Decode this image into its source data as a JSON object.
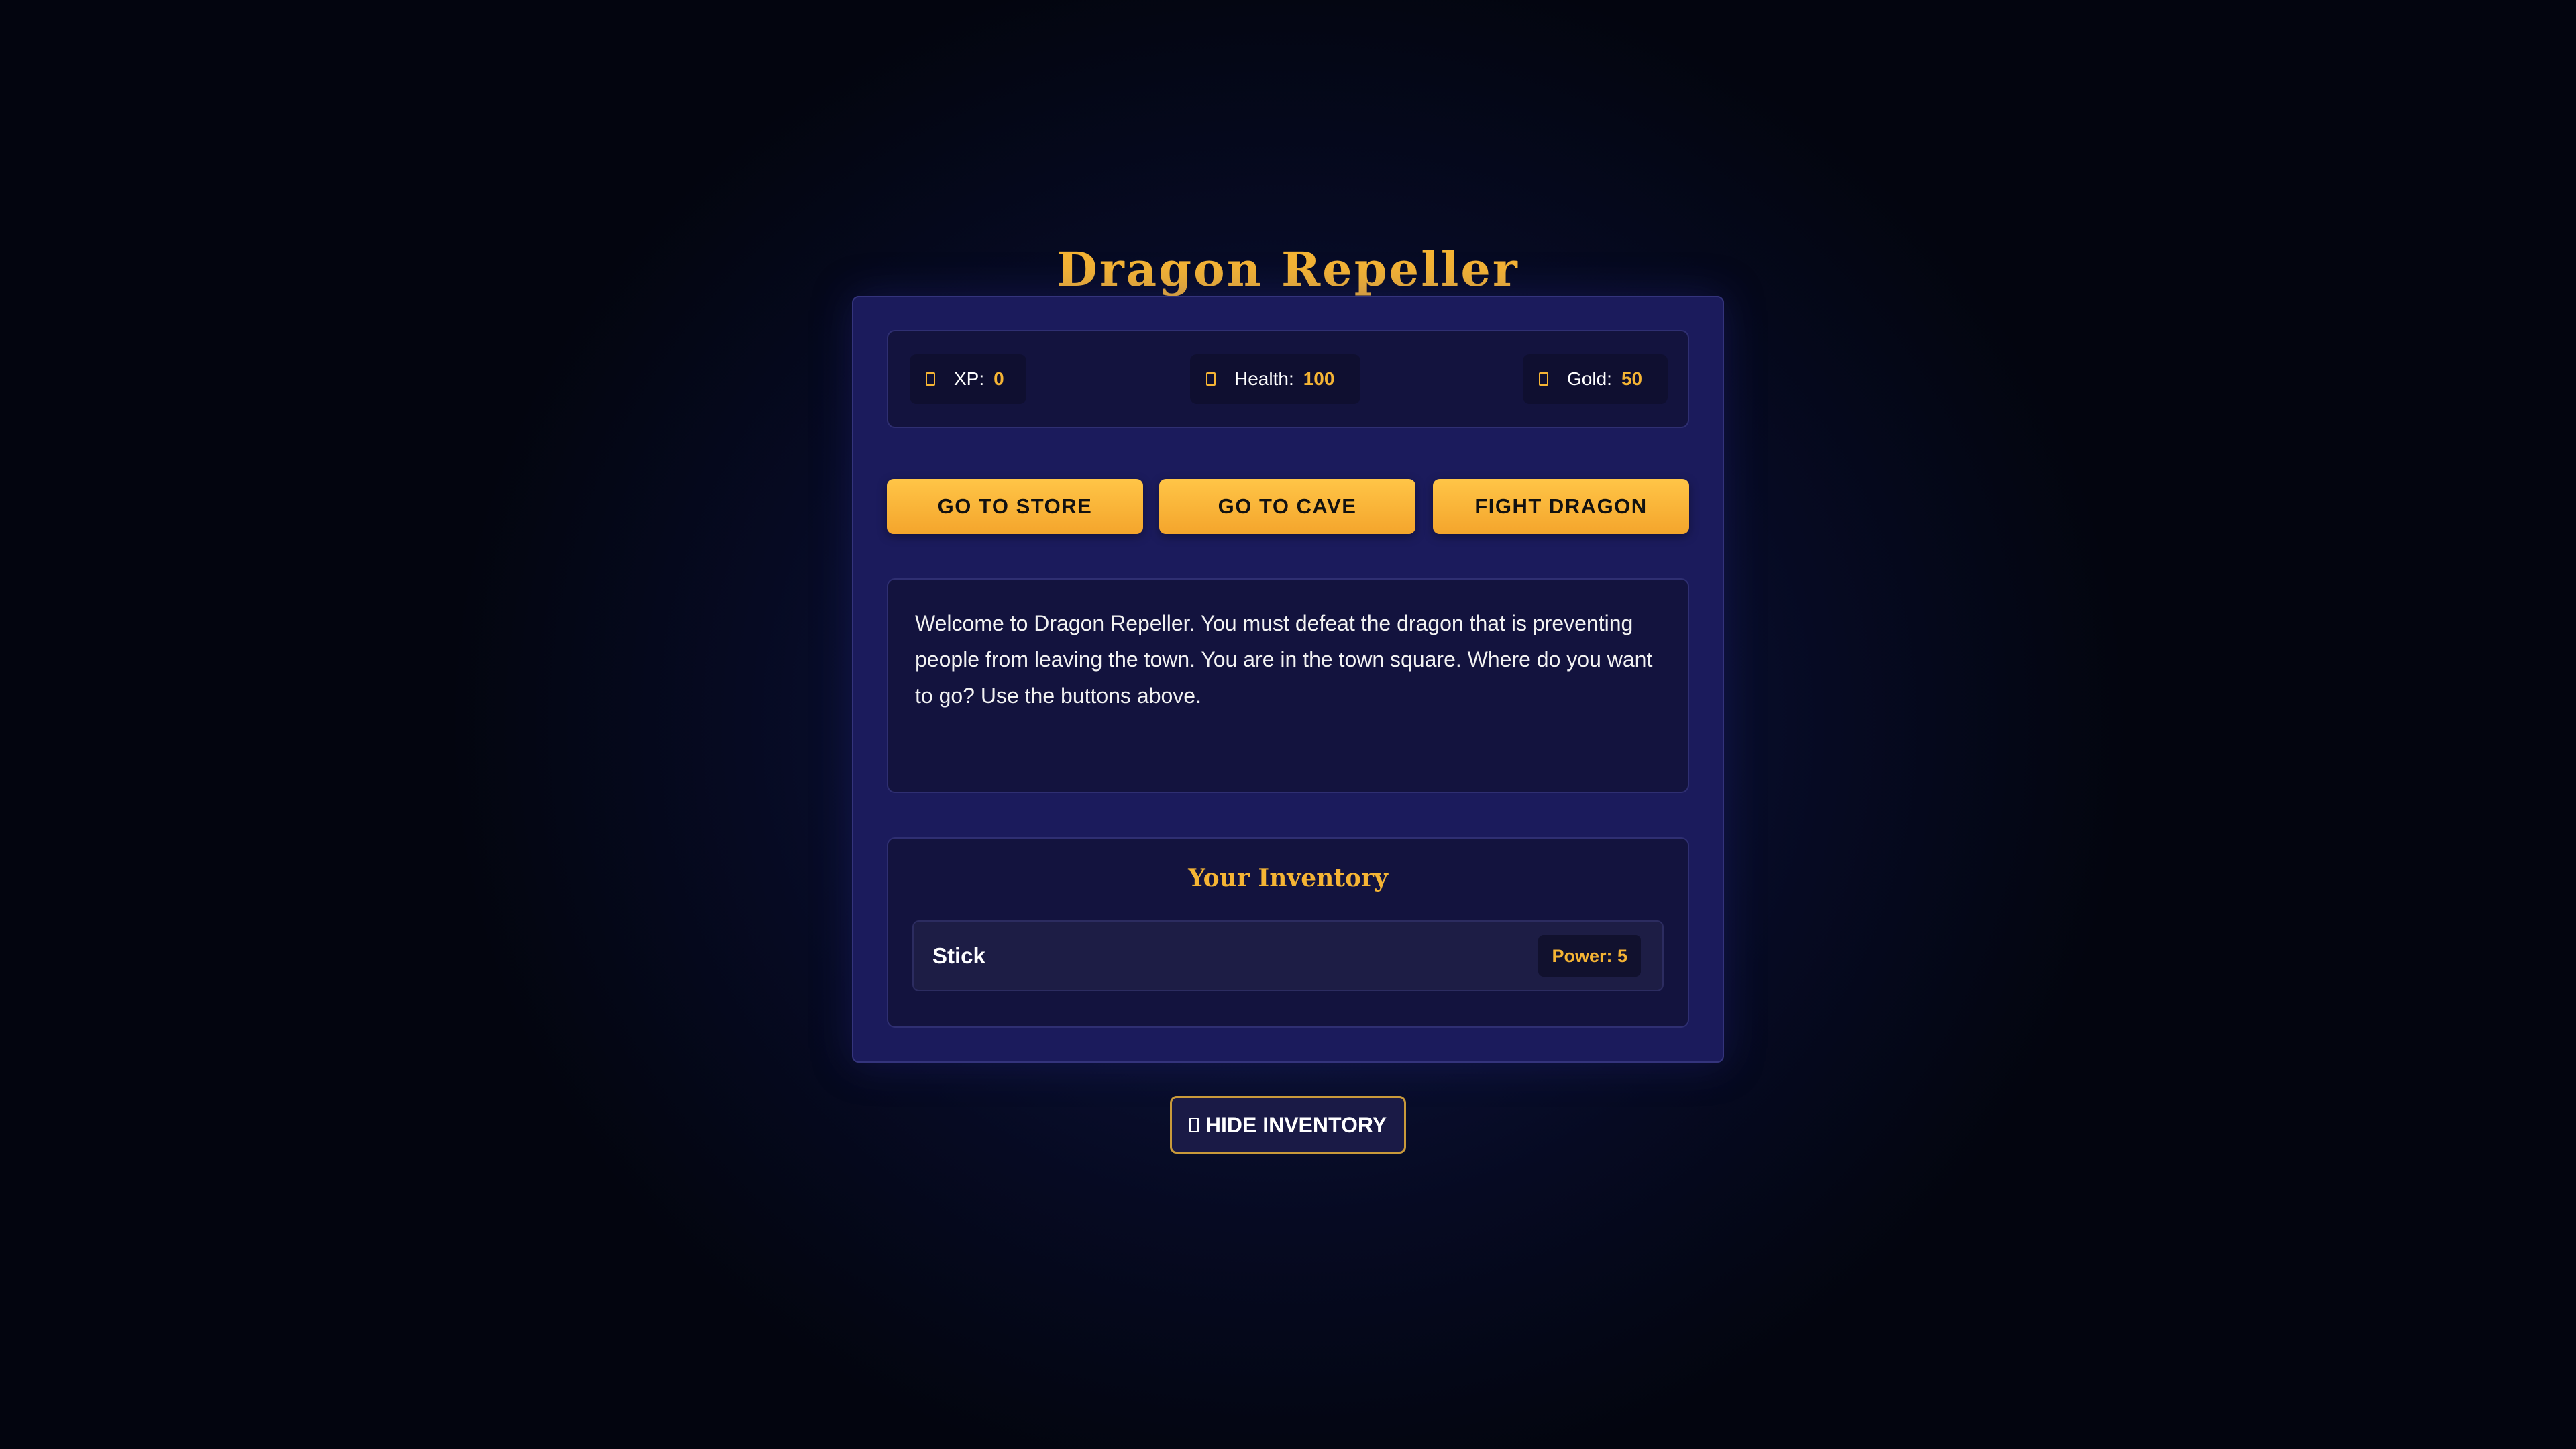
{
  "game": {
    "title": "Dragon Repeller"
  },
  "stats": {
    "xp": {
      "label": "XP:",
      "value": "0",
      "icon": "xp-icon"
    },
    "health": {
      "label": "Health:",
      "value": "100",
      "icon": "health-icon"
    },
    "gold": {
      "label": "Gold:",
      "value": "50",
      "icon": "gold-icon"
    }
  },
  "actions": {
    "store": "GO TO STORE",
    "cave": "GO TO CAVE",
    "dragon": "FIGHT DRAGON"
  },
  "message": "Welcome to Dragon Repeller. You must defeat the dragon that is preventing people from leaving the town. You are in the town square. Where do you want to go? Use the buttons above.",
  "inventory": {
    "title": "Your Inventory",
    "items": [
      {
        "name": "Stick",
        "power": "Power: 5"
      }
    ]
  },
  "toggle": {
    "label": "HIDE INVENTORY",
    "icon": "inventory-icon"
  },
  "colors": {
    "accent": "#f5b434",
    "panel": "#1b1b5c",
    "background": "#060a22"
  }
}
